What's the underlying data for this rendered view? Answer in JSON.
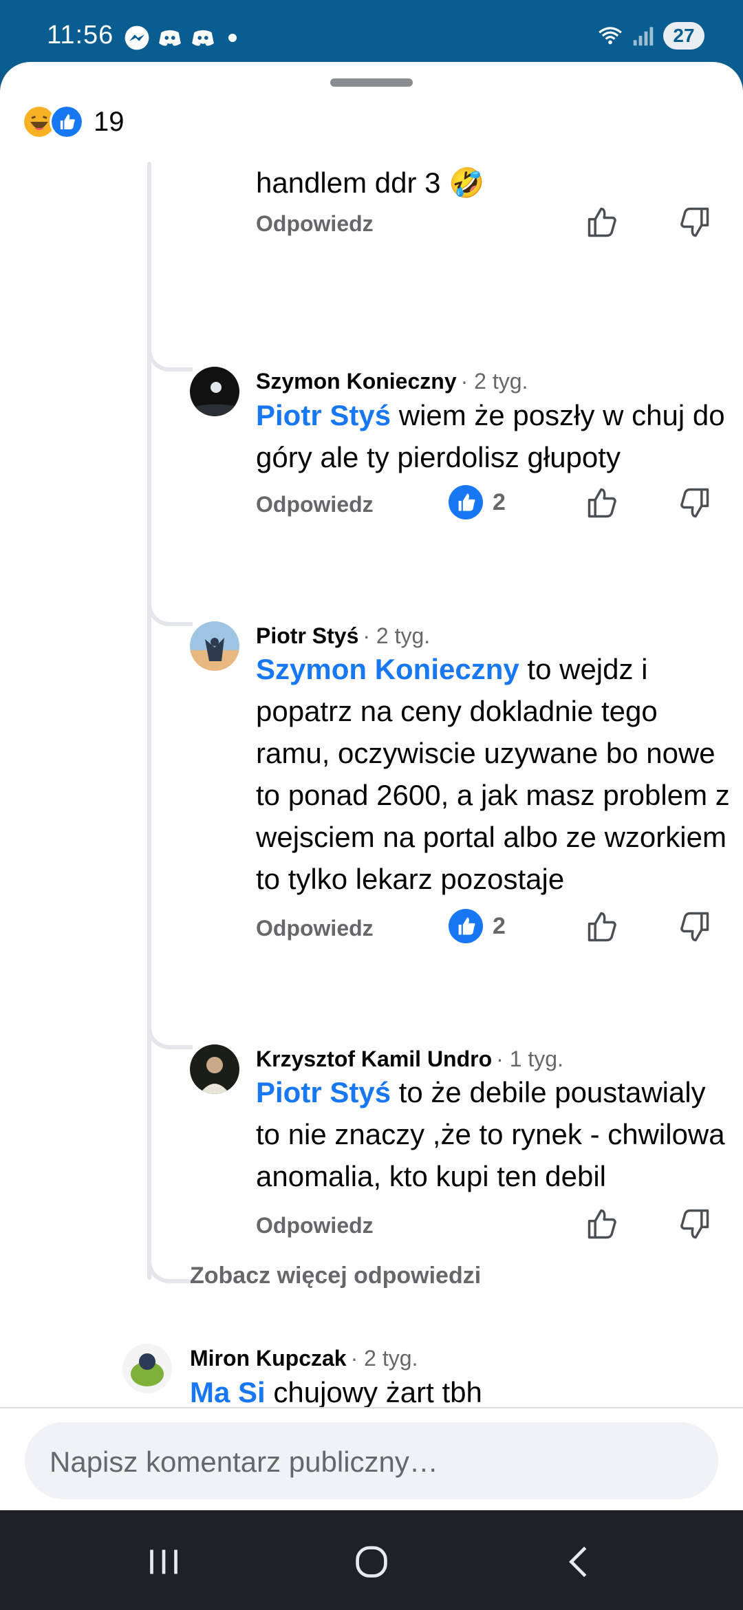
{
  "status": {
    "time": "11:56",
    "battery": "27"
  },
  "reactions": {
    "count": "19"
  },
  "comments": [
    {
      "text_tail": "handlem ddr 3 🤣",
      "reply": "Odpowiedz"
    },
    {
      "author": "Szymon Konieczny",
      "time": "· 2 tyg.",
      "mention": "Piotr Styś",
      "text": " wiem że poszły w chuj do góry ale ty pierdolisz głupoty",
      "reply": "Odpowiedz",
      "likes": "2"
    },
    {
      "author": "Piotr Styś",
      "time": "· 2 tyg.",
      "mention": "Szymon Konieczny",
      "text": " to wejdz i popatrz na ceny dokladnie tego ramu, oczywiscie uzywane bo nowe to ponad 2600, a jak masz problem z wejsciem na portal albo ze wzorkiem to tylko lekarz pozostaje",
      "reply": "Odpowiedz",
      "likes": "2"
    },
    {
      "author": "Krzysztof Kamil Undro",
      "time": "· 1 tyg.",
      "mention": "Piotr Styś",
      "text": " to że debile poustawialy to nie znaczy ,że to rynek - chwilowa anomalia, kto kupi ten debil",
      "reply": "Odpowiedz"
    },
    {
      "author": "Miron Kupczak",
      "time": "· 2 tyg.",
      "mention": "Ma Si",
      "text": " chujowy żart tbh"
    }
  ],
  "more_replies": "Zobacz więcej odpowiedzi",
  "input": {
    "placeholder": "Napisz komentarz publiczny…"
  },
  "icons": {
    "messenger": "messenger-icon",
    "discord": "discord-icon",
    "wifi": "wifi-icon",
    "signal": "signal-icon",
    "haha": "haha-reaction-icon",
    "like": "like-reaction-icon",
    "thumb_up": "thumb-up-icon",
    "thumb_down": "thumb-down-icon",
    "recents": "recents-icon",
    "home": "home-icon",
    "back": "back-icon"
  },
  "colors": {
    "accent": "#1877f2",
    "statusbar": "#0a5d91",
    "muted": "#65676b"
  }
}
